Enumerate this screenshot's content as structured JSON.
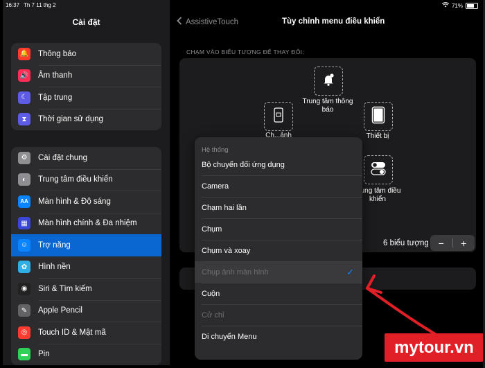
{
  "status_bar": {
    "time": "16:37",
    "date": "Th 7 11 thg 2",
    "battery": "71%"
  },
  "sidebar": {
    "title": "Cài đặt",
    "group1": [
      {
        "label": "Thông báo",
        "icon": "bell-icon",
        "color": "#ff3b30",
        "glyph": "🔔"
      },
      {
        "label": "Âm thanh",
        "icon": "speaker-icon",
        "color": "#ff2d55",
        "glyph": "🔊"
      },
      {
        "label": "Tập trung",
        "icon": "moon-icon",
        "color": "#5e5ce6",
        "glyph": "☾"
      },
      {
        "label": "Thời gian sử dụng",
        "icon": "hourglass-icon",
        "color": "#5e5ce6",
        "glyph": "⧗"
      }
    ],
    "group2": [
      {
        "label": "Cài đặt chung",
        "icon": "gear-icon",
        "color": "#8e8e93",
        "glyph": "⚙"
      },
      {
        "label": "Trung tâm điều khiển",
        "icon": "toggles-icon",
        "color": "#8e8e93",
        "glyph": "◐"
      },
      {
        "label": "Màn hình & Độ sáng",
        "icon": "text-size-icon",
        "color": "#0a84ff",
        "glyph": "AA"
      },
      {
        "label": "Màn hình chính & Đa nhiệm",
        "icon": "grid-icon",
        "color": "#3a47d6",
        "glyph": "▦"
      },
      {
        "label": "Trợ năng",
        "icon": "accessibility-icon",
        "color": "#0a84ff",
        "glyph": "☺"
      },
      {
        "label": "Hình nền",
        "icon": "flower-icon",
        "color": "#32ade6",
        "glyph": "✿"
      },
      {
        "label": "Siri & Tìm kiếm",
        "icon": "siri-icon",
        "color": "#222222",
        "glyph": "◉"
      },
      {
        "label": "Apple Pencil",
        "icon": "pencil-icon",
        "color": "#636366",
        "glyph": "✎"
      },
      {
        "label": "Touch ID & Mật mã",
        "icon": "fingerprint-icon",
        "color": "#ff3b30",
        "glyph": "◎"
      },
      {
        "label": "Pin",
        "icon": "battery-icon",
        "color": "#30d158",
        "glyph": "▬"
      }
    ],
    "active_index": 4
  },
  "main": {
    "back_label": "AssistiveTouch",
    "title": "Tùy chỉnh menu điều khiển",
    "section_label": "CHẠM VÀO BIỂU TƯỢNG ĐỂ THAY ĐỔI:",
    "slots": {
      "top": "Trung tâm thông báo",
      "left": "Chụp ảnh màn hình",
      "left_partial": "Ch...ảnh",
      "right": "Thiết bị",
      "bottom_right": "Trung tâm điều khiển"
    },
    "icon_count": "6 biểu tượng",
    "stepper": {
      "minus": "−",
      "plus": "+"
    }
  },
  "menu": {
    "header": "Hệ thống",
    "items": [
      {
        "label": "Bộ chuyển đổi ứng dụng"
      },
      {
        "label": "Camera"
      },
      {
        "label": "Chạm hai lần"
      },
      {
        "label": "Chụm"
      },
      {
        "label": "Chụm và xoay"
      },
      {
        "label": "Chụp ảnh màn hình"
      },
      {
        "label": "Cuộn"
      },
      {
        "label": "Cử chỉ"
      },
      {
        "label": "Di chuyển Menu"
      }
    ],
    "selected_index": 5,
    "check_glyph": "✓"
  },
  "watermark": "mytour.vn"
}
